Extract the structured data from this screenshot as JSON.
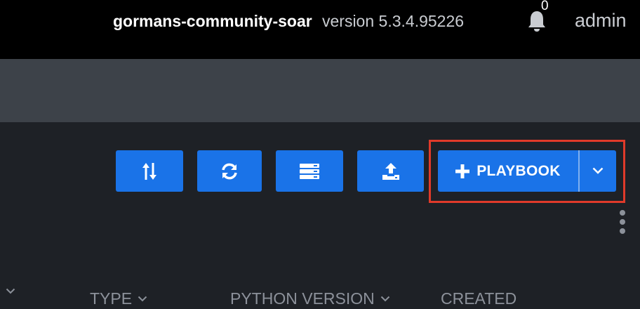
{
  "header": {
    "instance_name": "gormans-community-soar",
    "version": "version 5.3.4.95226",
    "notification_count": "0",
    "user": "admin"
  },
  "toolbar": {
    "buttons": [
      {
        "icon": "sort-icon"
      },
      {
        "icon": "refresh-icon"
      },
      {
        "icon": "server-list-icon"
      },
      {
        "icon": "upload-icon"
      }
    ],
    "primary_action": {
      "label": "PLAYBOOK",
      "icon": "plus-icon",
      "menu_icon": "chevron-down-icon"
    },
    "highlight_color": "#e03a2a",
    "button_color": "#1a73e8"
  },
  "table": {
    "columns": [
      {
        "label": ""
      },
      {
        "label": "TYPE"
      },
      {
        "label": "PYTHON VERSION"
      },
      {
        "label": "CREATED"
      }
    ]
  }
}
